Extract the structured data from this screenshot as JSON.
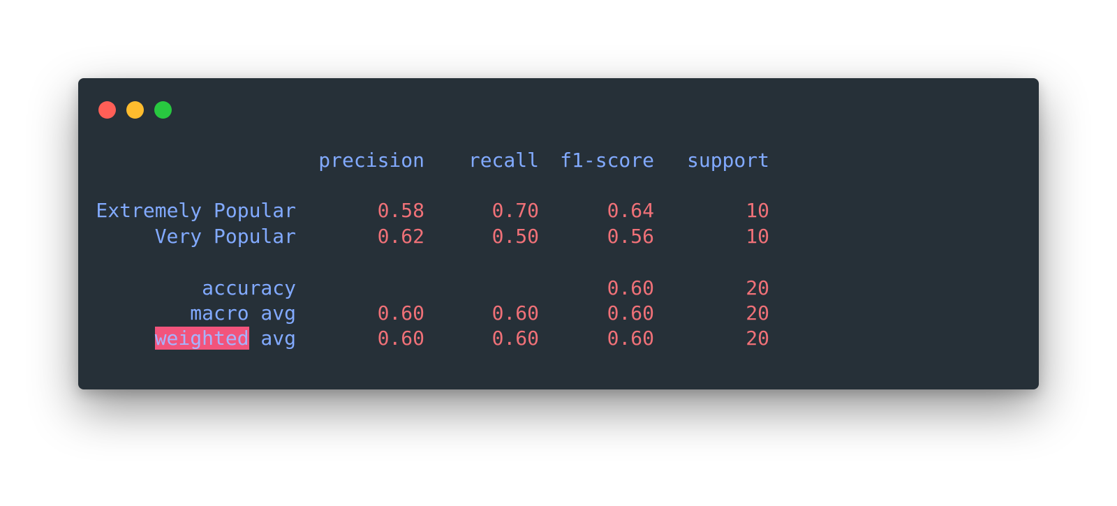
{
  "window": {
    "controls": [
      "close",
      "minimize",
      "zoom"
    ]
  },
  "report": {
    "headers": {
      "precision": "precision",
      "recall": "recall",
      "f1": "f1-score",
      "support": "support"
    },
    "rows": [
      {
        "label": "Extremely Popular",
        "precision": "0.58",
        "recall": "0.70",
        "f1": "0.64",
        "support": "10"
      },
      {
        "label": "Very Popular",
        "precision": "0.62",
        "recall": "0.50",
        "f1": "0.56",
        "support": "10"
      }
    ],
    "accuracy": {
      "label": "accuracy",
      "f1": "0.60",
      "support": "20"
    },
    "macro": {
      "label": "macro avg",
      "precision": "0.60",
      "recall": "0.60",
      "f1": "0.60",
      "support": "20"
    },
    "weighted": {
      "label_highlight": "weighted",
      "label_rest": " avg",
      "precision": "0.60",
      "recall": "0.60",
      "f1": "0.60",
      "support": "20"
    }
  },
  "colors": {
    "background": "#263038",
    "label": "#82aaff",
    "number": "#f07178",
    "highlight": "#f2547c"
  }
}
